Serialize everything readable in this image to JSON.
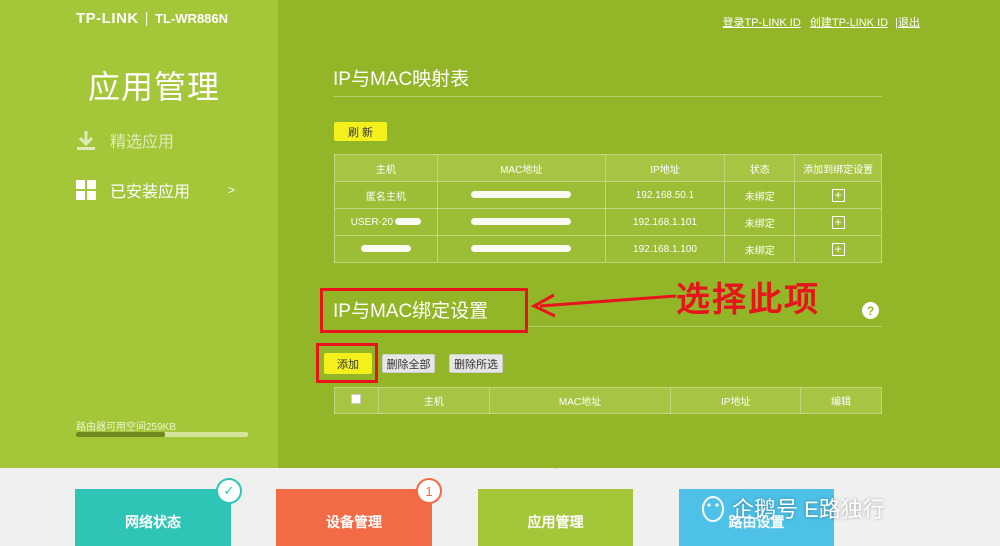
{
  "header": {
    "brand": "TP-LINK",
    "separator": "|",
    "model": "TL-WR886N",
    "links": [
      "登录TP-LINK ID",
      "创建TP-LINK ID"
    ],
    "logout": "|退出"
  },
  "sidebar": {
    "title": "应用管理",
    "items": [
      {
        "label": "精选应用",
        "icon": "download-icon"
      },
      {
        "label": "已安装应用",
        "icon": "grid-icon",
        "chevron": ">"
      }
    ],
    "storage_label": "路由器可用空间259KB",
    "storage_fill": 0.52
  },
  "mapping_table": {
    "title": "IP与MAC映射表",
    "refresh_label": "刷 新",
    "headers": [
      "主机",
      "MAC地址",
      "IP地址",
      "状态",
      "添加到绑定设置"
    ],
    "rows": [
      {
        "host": "匿名主机",
        "ip": "192.168.50.1",
        "status": "未绑定"
      },
      {
        "host": "USER-20",
        "ip": "192.168.1.101",
        "status": "未绑定"
      },
      {
        "host": "",
        "ip": "192.168.1.100",
        "status": "未绑定"
      }
    ],
    "add_symbol": "+"
  },
  "binding": {
    "title": "IP与MAC绑定设置",
    "help": "?",
    "add_label": "添加",
    "delete_all_label": "删除全部",
    "delete_selected_label": "删除所选",
    "headers": [
      "主机",
      "MAC地址",
      "IP地址",
      "编辑"
    ]
  },
  "annotation": {
    "text": "选择此项",
    "color": "#e8141b"
  },
  "bottom_tabs": [
    {
      "label": "网络状态",
      "color": "#2ec4b6"
    },
    {
      "label": "设备管理",
      "color": "#f26b45",
      "badge": "1"
    },
    {
      "label": "应用管理",
      "color": "#a4c639"
    },
    {
      "label": "路由设置",
      "color": "#4dc1e8"
    }
  ],
  "watermark": {
    "text": "企鹅号 E路独行"
  }
}
